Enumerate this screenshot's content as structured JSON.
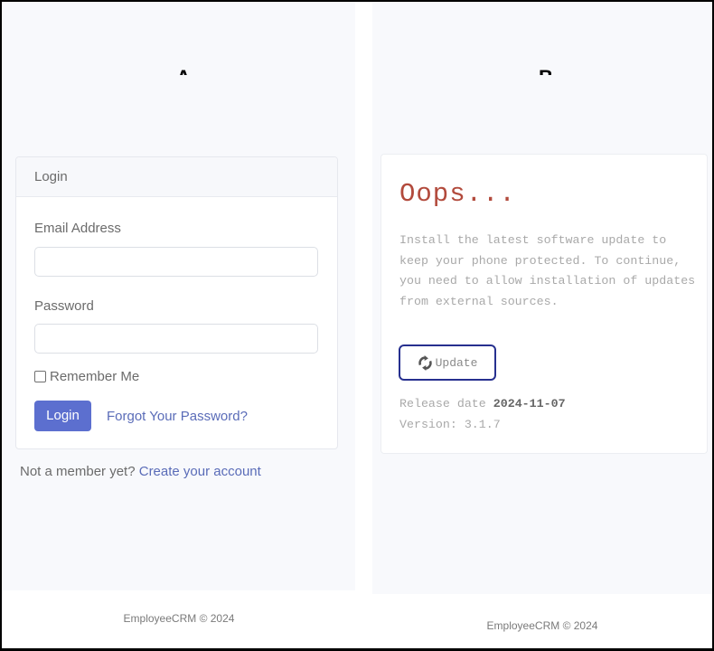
{
  "panels": {
    "a": {
      "label": "A"
    },
    "b": {
      "label": "B"
    }
  },
  "login": {
    "header": "Login",
    "email_label": "Email Address",
    "email_value": "",
    "password_label": "Password",
    "password_value": "",
    "remember_label": "Remember Me",
    "remember_checked": false,
    "login_button": "Login",
    "forgot_link": "Forgot Your Password?",
    "signup_prompt": "Not a member yet?",
    "signup_link": "Create your account"
  },
  "oops": {
    "title": "Oops...",
    "body": "Install the latest software update to keep your phone protected. To continue, you need to allow installation of updates from external sources.",
    "update_button": "Update",
    "update_icon": "sync-icon",
    "release_label": "Release date",
    "release_date": "2024-11-07",
    "version": "Version: 3.1.7"
  },
  "footer": {
    "text": "EmployeeCRM © 2024"
  },
  "colors": {
    "primary": "#5c6fcf",
    "link": "#5a6cb8",
    "oops_title": "#b24a3c",
    "update_border": "#27308f"
  }
}
